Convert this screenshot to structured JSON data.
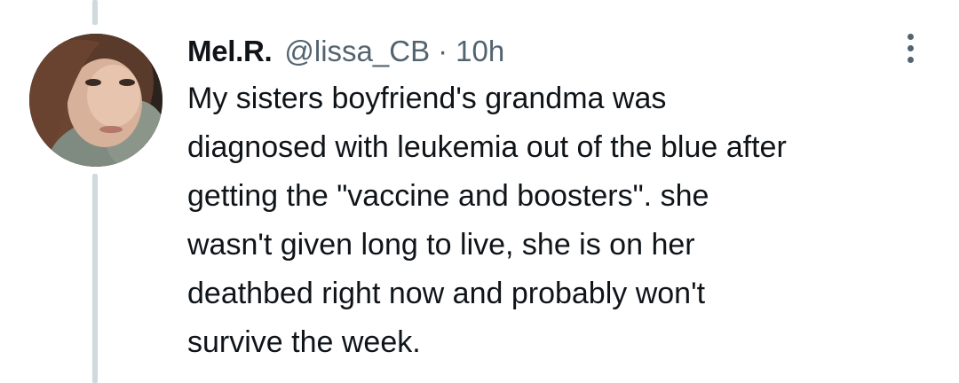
{
  "tweet": {
    "display_name": "Mel.R.",
    "handle": "@lissa_CB",
    "separator": "·",
    "time": "10h",
    "more_icon": "more-vertical-icon",
    "avatar_icon": "profile-photo",
    "text_lines": [
      "My sisters boyfriend's grandma was",
      "diagnosed with leukemia out of the blue after",
      "getting the \"vaccine and boosters\". she",
      "wasn't given long to live, she is on her",
      "deathbed right now and probably won't",
      "survive the week."
    ]
  },
  "colors": {
    "text_primary": "#0f1419",
    "text_secondary": "#536471",
    "thread_line": "#cfd9de"
  }
}
